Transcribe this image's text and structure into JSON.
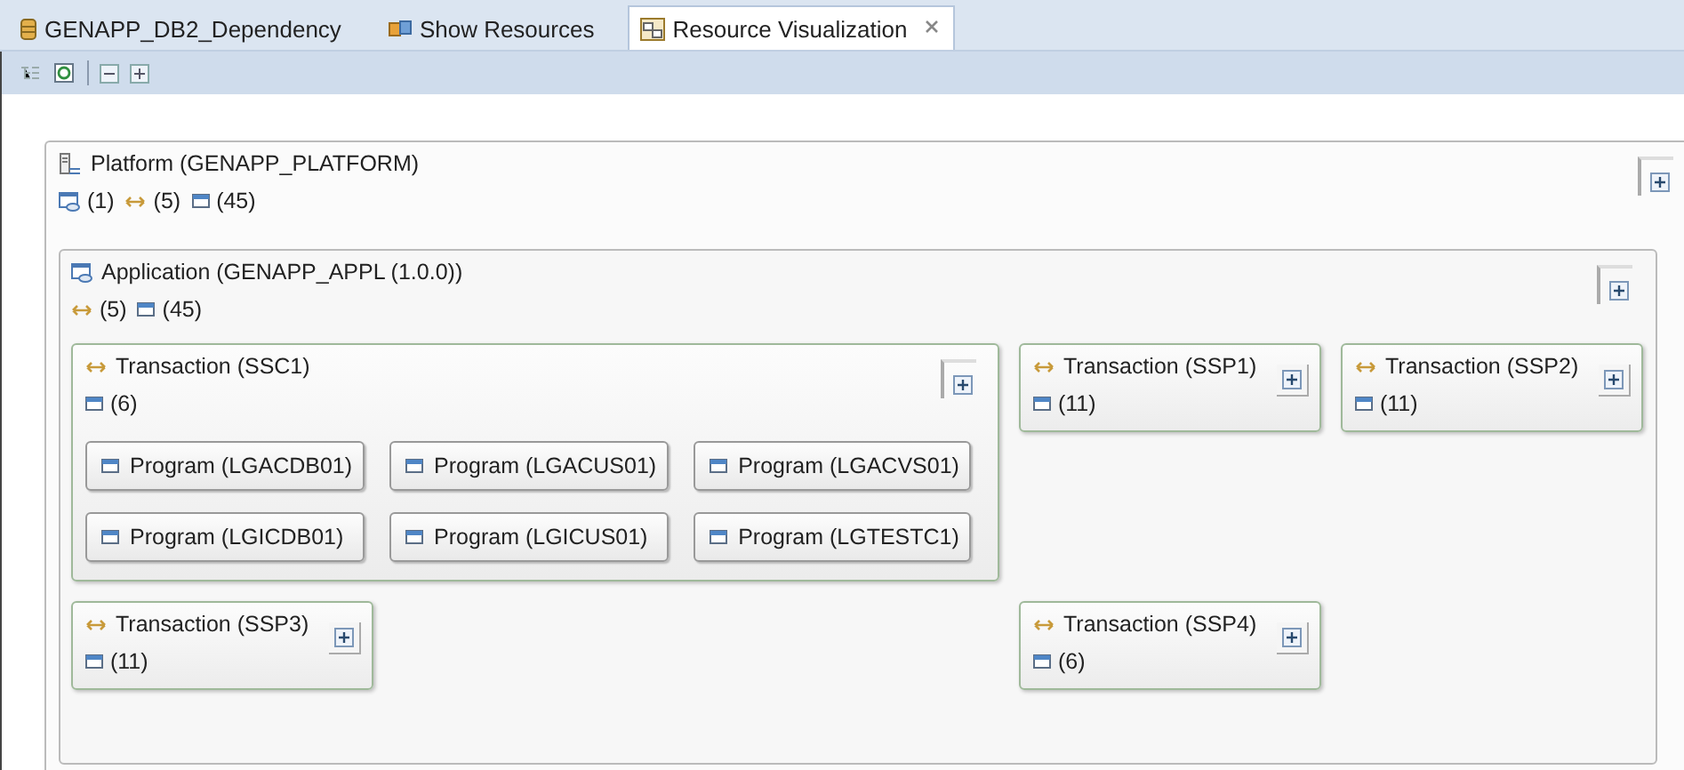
{
  "tabs": [
    {
      "label": "GENAPP_DB2_Dependency",
      "selected": false,
      "closable": false
    },
    {
      "label": "Show Resources",
      "selected": false,
      "closable": false
    },
    {
      "label": "Resource Visualization",
      "selected": true,
      "closable": true
    }
  ],
  "platform": {
    "title": "Platform (GENAPP_PLATFORM)",
    "counts": [
      {
        "kind": "application",
        "count": "(1)"
      },
      {
        "kind": "transaction",
        "count": "(5)"
      },
      {
        "kind": "program",
        "count": "(45)"
      }
    ],
    "application": {
      "title": "Application (GENAPP_APPL (1.0.0))",
      "counts": [
        {
          "kind": "transaction",
          "count": "(5)"
        },
        {
          "kind": "program",
          "count": "(45)"
        }
      ],
      "transactions": [
        {
          "title": "Transaction (SSC1)",
          "count": "(6)",
          "expanded": true,
          "programs": [
            "Program (LGACDB01)",
            "Program (LGACUS01)",
            "Program (LGACVS01)",
            "Program (LGICDB01)",
            "Program (LGICUS01)",
            "Program (LGTESTC1)"
          ]
        },
        {
          "title": "Transaction (SSP1)",
          "count": "(11)",
          "expanded": false
        },
        {
          "title": "Transaction (SSP2)",
          "count": "(11)",
          "expanded": false
        },
        {
          "title": "Transaction (SSP3)",
          "count": "(11)",
          "expanded": false
        },
        {
          "title": "Transaction (SSP4)",
          "count": "(6)",
          "expanded": false
        }
      ]
    }
  }
}
